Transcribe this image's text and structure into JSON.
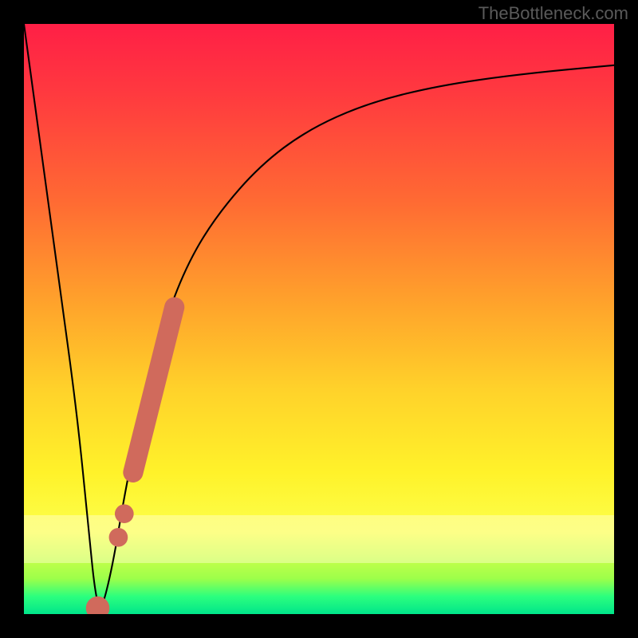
{
  "watermark": "TheBottleneck.com",
  "chart_data": {
    "type": "line",
    "title": "",
    "xlabel": "",
    "ylabel": "",
    "xlim": [
      0,
      100
    ],
    "ylim": [
      0,
      100
    ],
    "grid": false,
    "legend": false,
    "series": [
      {
        "name": "bottleneck-curve",
        "x": [
          0,
          3,
          6,
          9,
          11,
          12,
          13,
          15,
          17,
          20,
          24,
          28,
          33,
          40,
          48,
          58,
          70,
          84,
          100
        ],
        "y": [
          100,
          78,
          56,
          34,
          14,
          4,
          0,
          8,
          20,
          35,
          50,
          60,
          68,
          76,
          82,
          86.5,
          89.5,
          91.5,
          93
        ]
      }
    ],
    "markers": [
      {
        "name": "segment-thick",
        "x0": 18.5,
        "y0": 24,
        "x1": 25.5,
        "y1": 52,
        "thickness": 3.4,
        "color": "#d06a5c"
      },
      {
        "name": "dot-a",
        "x": 17.0,
        "y": 17,
        "r": 1.6,
        "color": "#d06a5c"
      },
      {
        "name": "dot-b",
        "x": 16.0,
        "y": 13,
        "r": 1.6,
        "color": "#d06a5c"
      },
      {
        "name": "dot-low",
        "x": 12.5,
        "y": 1,
        "r": 2.0,
        "color": "#d06a5c"
      }
    ],
    "gradient_stops": [
      {
        "pos": 0,
        "color": "#ff1f46"
      },
      {
        "pos": 12,
        "color": "#ff3a3f"
      },
      {
        "pos": 30,
        "color": "#ff6a33"
      },
      {
        "pos": 48,
        "color": "#ffa52b"
      },
      {
        "pos": 62,
        "color": "#ffd22a"
      },
      {
        "pos": 76,
        "color": "#fff22a"
      },
      {
        "pos": 86,
        "color": "#fcff4a"
      },
      {
        "pos": 94,
        "color": "#9dff4a"
      },
      {
        "pos": 97,
        "color": "#2cff7e"
      },
      {
        "pos": 100,
        "color": "#00e58a"
      }
    ]
  }
}
